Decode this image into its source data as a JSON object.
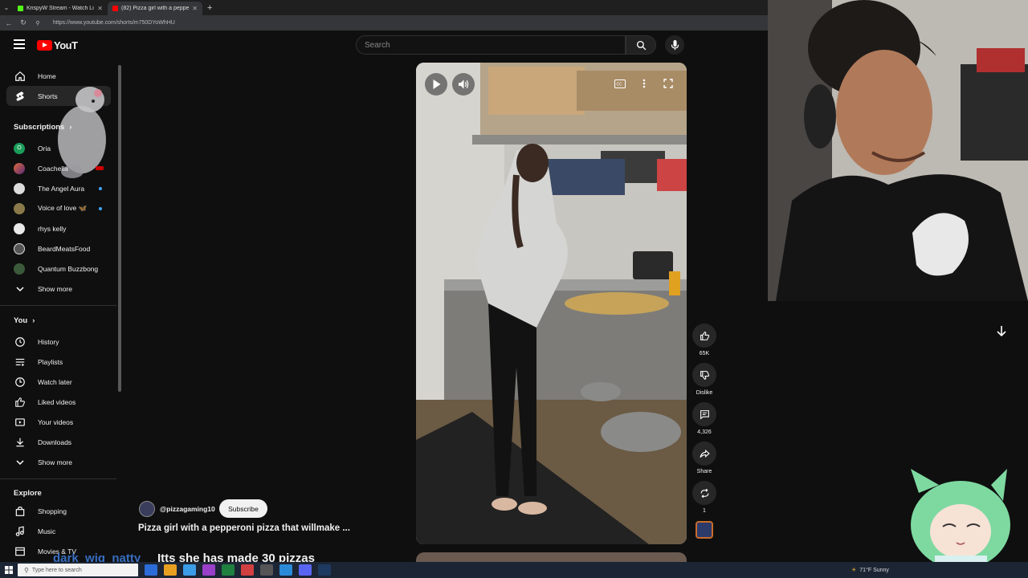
{
  "browser": {
    "tabs": [
      {
        "title": "KrispyW Stream - Watch Live on K",
        "favicon_color": "#53fc18"
      },
      {
        "title": "(82) Pizza girl with a pepperoni p",
        "favicon_color": "#ff0000"
      }
    ],
    "url": "https://www.youtube.com/shorts/m750DYoWhHU"
  },
  "header": {
    "logo_text": "YouT",
    "search_placeholder": "Search"
  },
  "sidebar": {
    "main": [
      {
        "label": "Home",
        "icon": "home-icon"
      },
      {
        "label": "Shorts",
        "icon": "shorts-icon"
      }
    ],
    "subscriptions_heading": "Subscriptions",
    "subscriptions": [
      {
        "label": "Oria",
        "avatar": "O",
        "color": "#1a9d5a"
      },
      {
        "label": "Coachella",
        "avatar": "",
        "color": "#6a3a7a"
      },
      {
        "label": "The Angel Aura",
        "avatar": "",
        "color": "#dcdcdc"
      },
      {
        "label": "Voice of love 🦋",
        "avatar": "",
        "color": "#8a7a4a"
      },
      {
        "label": "rhys kelly",
        "avatar": "",
        "color": "#eaeaea"
      },
      {
        "label": "BeardMeatsFood",
        "avatar": "",
        "color": "#555555"
      },
      {
        "label": "Quantum Buzzbong",
        "avatar": "",
        "color": "#3b5a3b"
      }
    ],
    "subs_show_more": "Show more",
    "you_heading": "You",
    "you_items": [
      {
        "label": "History",
        "icon": "history-icon"
      },
      {
        "label": "Playlists",
        "icon": "playlists-icon"
      },
      {
        "label": "Watch later",
        "icon": "watch-later-icon"
      },
      {
        "label": "Liked videos",
        "icon": "liked-videos-icon"
      },
      {
        "label": "Your videos",
        "icon": "your-videos-icon"
      },
      {
        "label": "Downloads",
        "icon": "downloads-icon"
      }
    ],
    "you_show_more": "Show more",
    "explore_heading": "Explore",
    "explore_items": [
      {
        "label": "Shopping",
        "icon": "shopping-icon"
      },
      {
        "label": "Music",
        "icon": "music-icon"
      },
      {
        "label": "Movies & TV",
        "icon": "movies-icon"
      }
    ]
  },
  "short": {
    "channel": "@pizzagaming10",
    "subscribe_label": "Subscribe",
    "title": "Pizza girl with a pepperoni pizza that willmake ...",
    "actions": {
      "like_count": "65K",
      "dislike_label": "Dislike",
      "comment_count": "4,326",
      "share_label": "Share",
      "remix_count": "1"
    }
  },
  "stream_overlay": {
    "chat_user": "dark_wig_natty",
    "chat_message": "Itts she has made 30 pizzas"
  },
  "taskbar": {
    "search_placeholder": "Type here to search",
    "weather": "71°F Sunny"
  }
}
